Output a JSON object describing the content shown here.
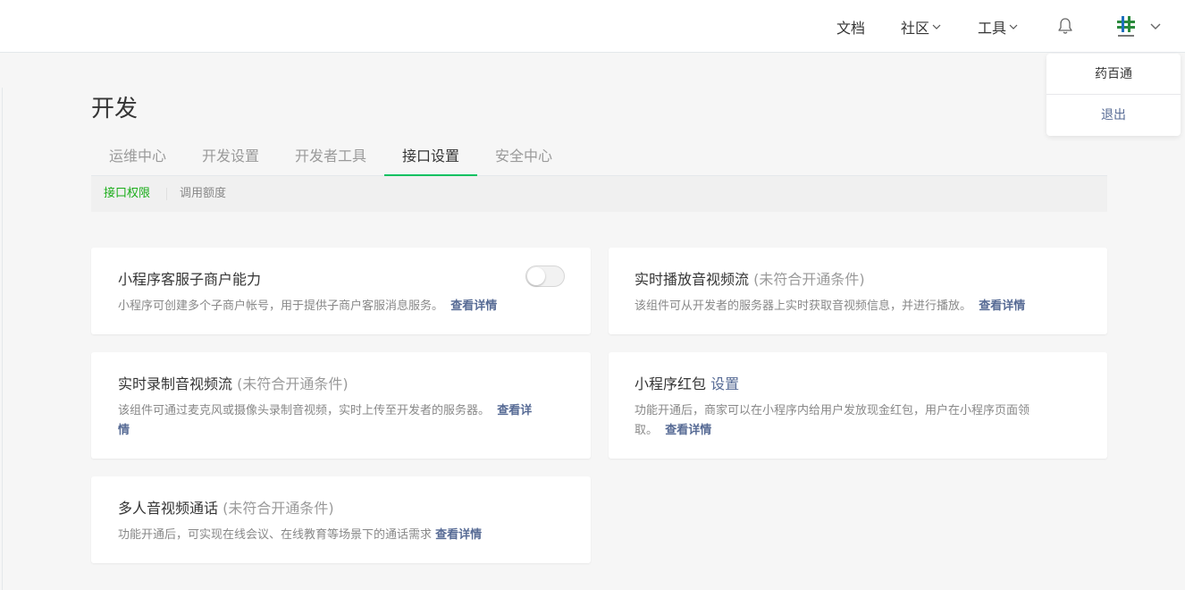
{
  "header": {
    "nav": {
      "docs": "文档",
      "community": "社区",
      "tools": "工具"
    },
    "icons": {
      "bell": "bell-icon",
      "avatar": "app-logo",
      "caret": "chevron-down-icon"
    }
  },
  "account_menu": {
    "name": "药百通",
    "logout": "退出"
  },
  "page": {
    "title": "开发"
  },
  "tabs": [
    {
      "label": "运维中心",
      "active": false
    },
    {
      "label": "开发设置",
      "active": false
    },
    {
      "label": "开发者工具",
      "active": false
    },
    {
      "label": "接口设置",
      "active": true
    },
    {
      "label": "安全中心",
      "active": false
    }
  ],
  "subtabs": [
    {
      "label": "接口权限",
      "active": true
    },
    {
      "label": "调用额度",
      "active": false
    }
  ],
  "cards": {
    "cs_merchant": {
      "title": "小程序客服子商户能力",
      "toggle_on": false,
      "desc": "小程序可创建多个子商户帐号，用于提供子商户客服消息服务。",
      "link": "查看详情"
    },
    "live_play": {
      "title": "实时播放音视频流",
      "status": "(未符合开通条件)",
      "desc": "该组件可从开发者的服务器上实时获取音视频信息，并进行播放。",
      "link": "查看详情"
    },
    "live_push": {
      "title": "实时录制音视频流",
      "status": "(未符合开通条件)",
      "desc_line1": "该组件可通过麦克风或摄像头录制音视频，实时上传至开发者的服务器。",
      "link_part1": "查看详",
      "link_part2": "情"
    },
    "red_packet": {
      "title": "小程序红包",
      "setting_link": "设置",
      "desc_line1": "功能开通后，商家可以在小程序内给用户发放现金红包，用户在小程序页面领",
      "desc_line2": "取。",
      "link": "查看详情"
    },
    "multi_voip": {
      "title": "多人音视频通话",
      "status": "(未符合开通条件)",
      "desc": "功能开通后，可实现在线会议、在线教育等场景下的通话需求",
      "link": "查看详情"
    }
  },
  "colors": {
    "accent_green": "#07c160",
    "link_blue": "#576b95",
    "muted_text": "#888888"
  }
}
